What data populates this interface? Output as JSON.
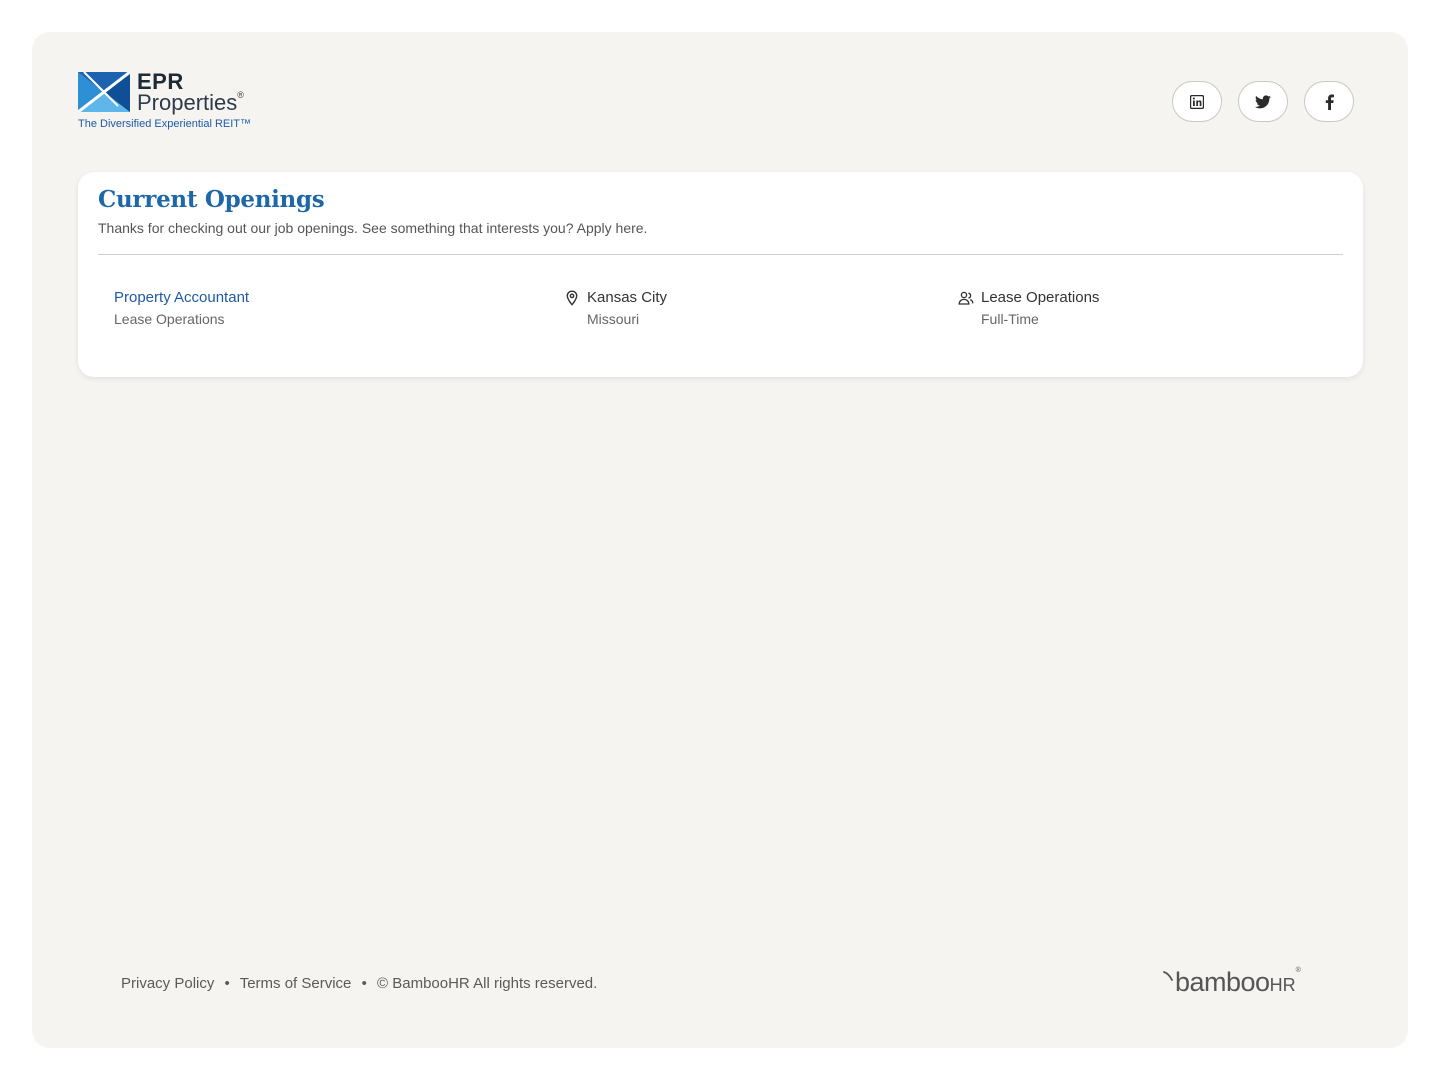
{
  "company": {
    "logo_name": "EPR",
    "logo_name2": "Properties",
    "logo_reg": "®",
    "tagline": "The Diversified Experiential REIT™"
  },
  "social": [
    {
      "name": "linkedin",
      "icon": "linkedin-icon"
    },
    {
      "name": "twitter",
      "icon": "twitter-icon"
    },
    {
      "name": "facebook",
      "icon": "facebook-icon"
    }
  ],
  "openings": {
    "title": "Current Openings",
    "subtitle": "Thanks for checking out our job openings. See something that interests you? Apply here.",
    "jobs": [
      {
        "title": "Property Accountant",
        "department": "Lease Operations",
        "city": "Kansas City",
        "state": "Missouri",
        "team": "Lease Operations",
        "type": "Full-Time"
      }
    ]
  },
  "footer": {
    "privacy": "Privacy Policy",
    "bullet": "•",
    "terms": "Terms of Service",
    "copyright": "© BambooHR All rights reserved."
  },
  "brand": {
    "name": "bamboo",
    "hr": "HR",
    "reg": "®"
  },
  "colors": {
    "accent": "#1e68a8",
    "link": "#1e5ba6",
    "background": "#f5f4f1"
  }
}
